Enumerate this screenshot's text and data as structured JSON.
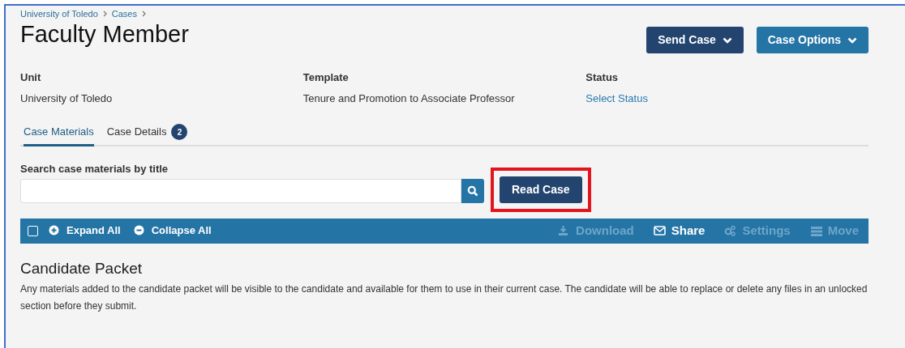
{
  "breadcrumb": [
    "University of Toledo",
    "Cases"
  ],
  "title": "Faculty Member",
  "header_buttons": [
    {
      "label": "Send Case",
      "kind": "dark"
    },
    {
      "label": "Case Options",
      "kind": "light"
    }
  ],
  "fields": [
    {
      "label": "Unit",
      "value": "University of Toledo",
      "kind": "text"
    },
    {
      "label": "Template",
      "value": "Tenure and Promotion to Associate Professor",
      "kind": "text"
    },
    {
      "label": "Status",
      "value": "Select Status",
      "kind": "link"
    }
  ],
  "tabs": [
    {
      "label": "Case Materials",
      "selected": true
    },
    {
      "label": "Case Details",
      "selected": false,
      "badge": "2"
    }
  ],
  "search": {
    "label": "Search case materials by title"
  },
  "read_case_button": {
    "label": "Read Case",
    "highlighted": true
  },
  "toolbar": {
    "checked": false,
    "left_actions": [
      {
        "label": "Expand All",
        "kind": "plus"
      },
      {
        "label": "Collapse All",
        "kind": "minus"
      }
    ],
    "right_actions": [
      {
        "label": "Download",
        "kind": "download",
        "disabled": true
      },
      {
        "label": "Share",
        "kind": "mail",
        "disabled": false
      },
      {
        "label": "Settings",
        "kind": "gears",
        "disabled": true
      },
      {
        "label": "Move",
        "kind": "list",
        "disabled": true
      }
    ]
  },
  "section": {
    "title": "Candidate Packet",
    "text": "Any materials added to the candidate packet will be visible to the candidate and available for them to use in their current case. The candidate will be able to replace or delete any files in an unlocked section before they submit."
  }
}
